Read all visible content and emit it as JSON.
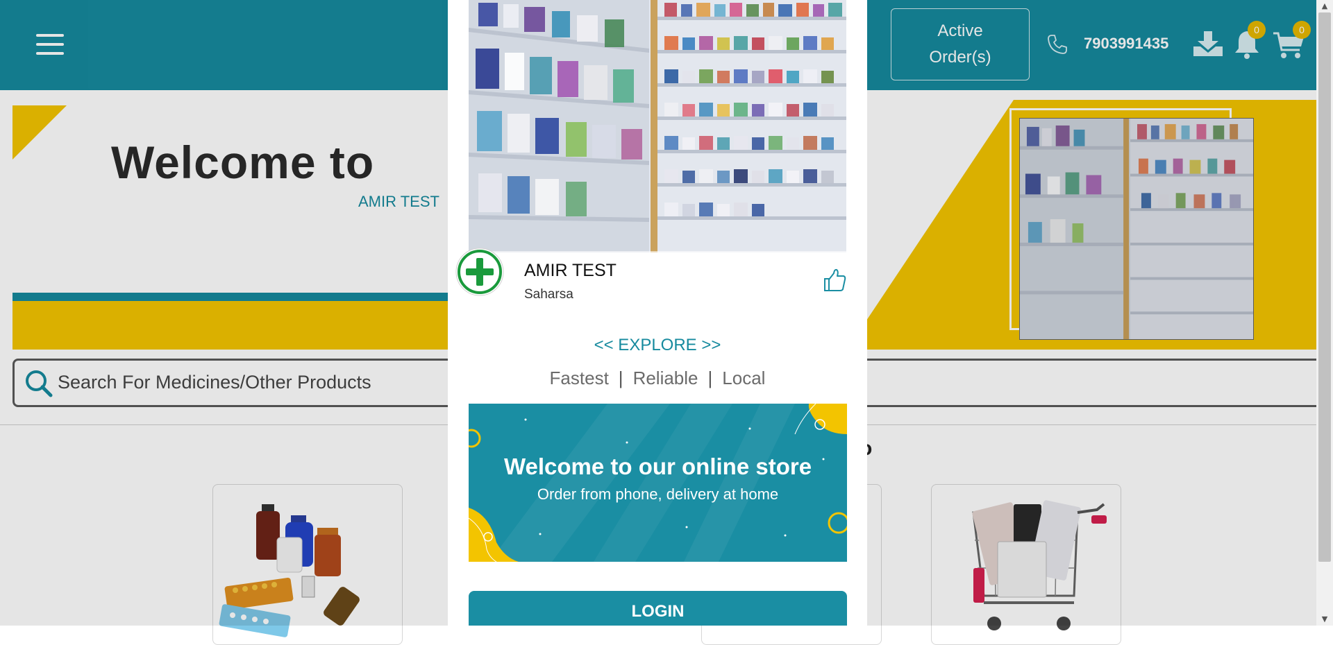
{
  "header": {
    "active_orders_label": "Active Order(s)",
    "phone": "7903991435",
    "notification_count": "0",
    "cart_count": "0"
  },
  "banner": {
    "welcome": "Welcome to",
    "store_name": "AMIR TEST"
  },
  "search": {
    "placeholder": "Search For Medicines/Other Products"
  },
  "modal": {
    "store_name": "AMIR TEST",
    "city": "Saharsa",
    "explore": "<< EXPLORE >>",
    "taglines": [
      "Fastest",
      "Reliable",
      "Local"
    ],
    "tagline_separator": "|",
    "promo_title": "Welcome to our online store",
    "promo_subtitle": "Order from phone, delivery at home",
    "login_label": "LOGIN"
  },
  "colors": {
    "brand_teal": "#168a9e",
    "accent_yellow": "#f3c400",
    "badge": "#e6b800",
    "logo_green": "#1a9a3c"
  },
  "icons": [
    "menu-icon",
    "phone-icon",
    "download-icon",
    "bell-icon",
    "cart-icon",
    "search-icon",
    "pharmacy-cross-icon",
    "thumbs-up-icon"
  ]
}
